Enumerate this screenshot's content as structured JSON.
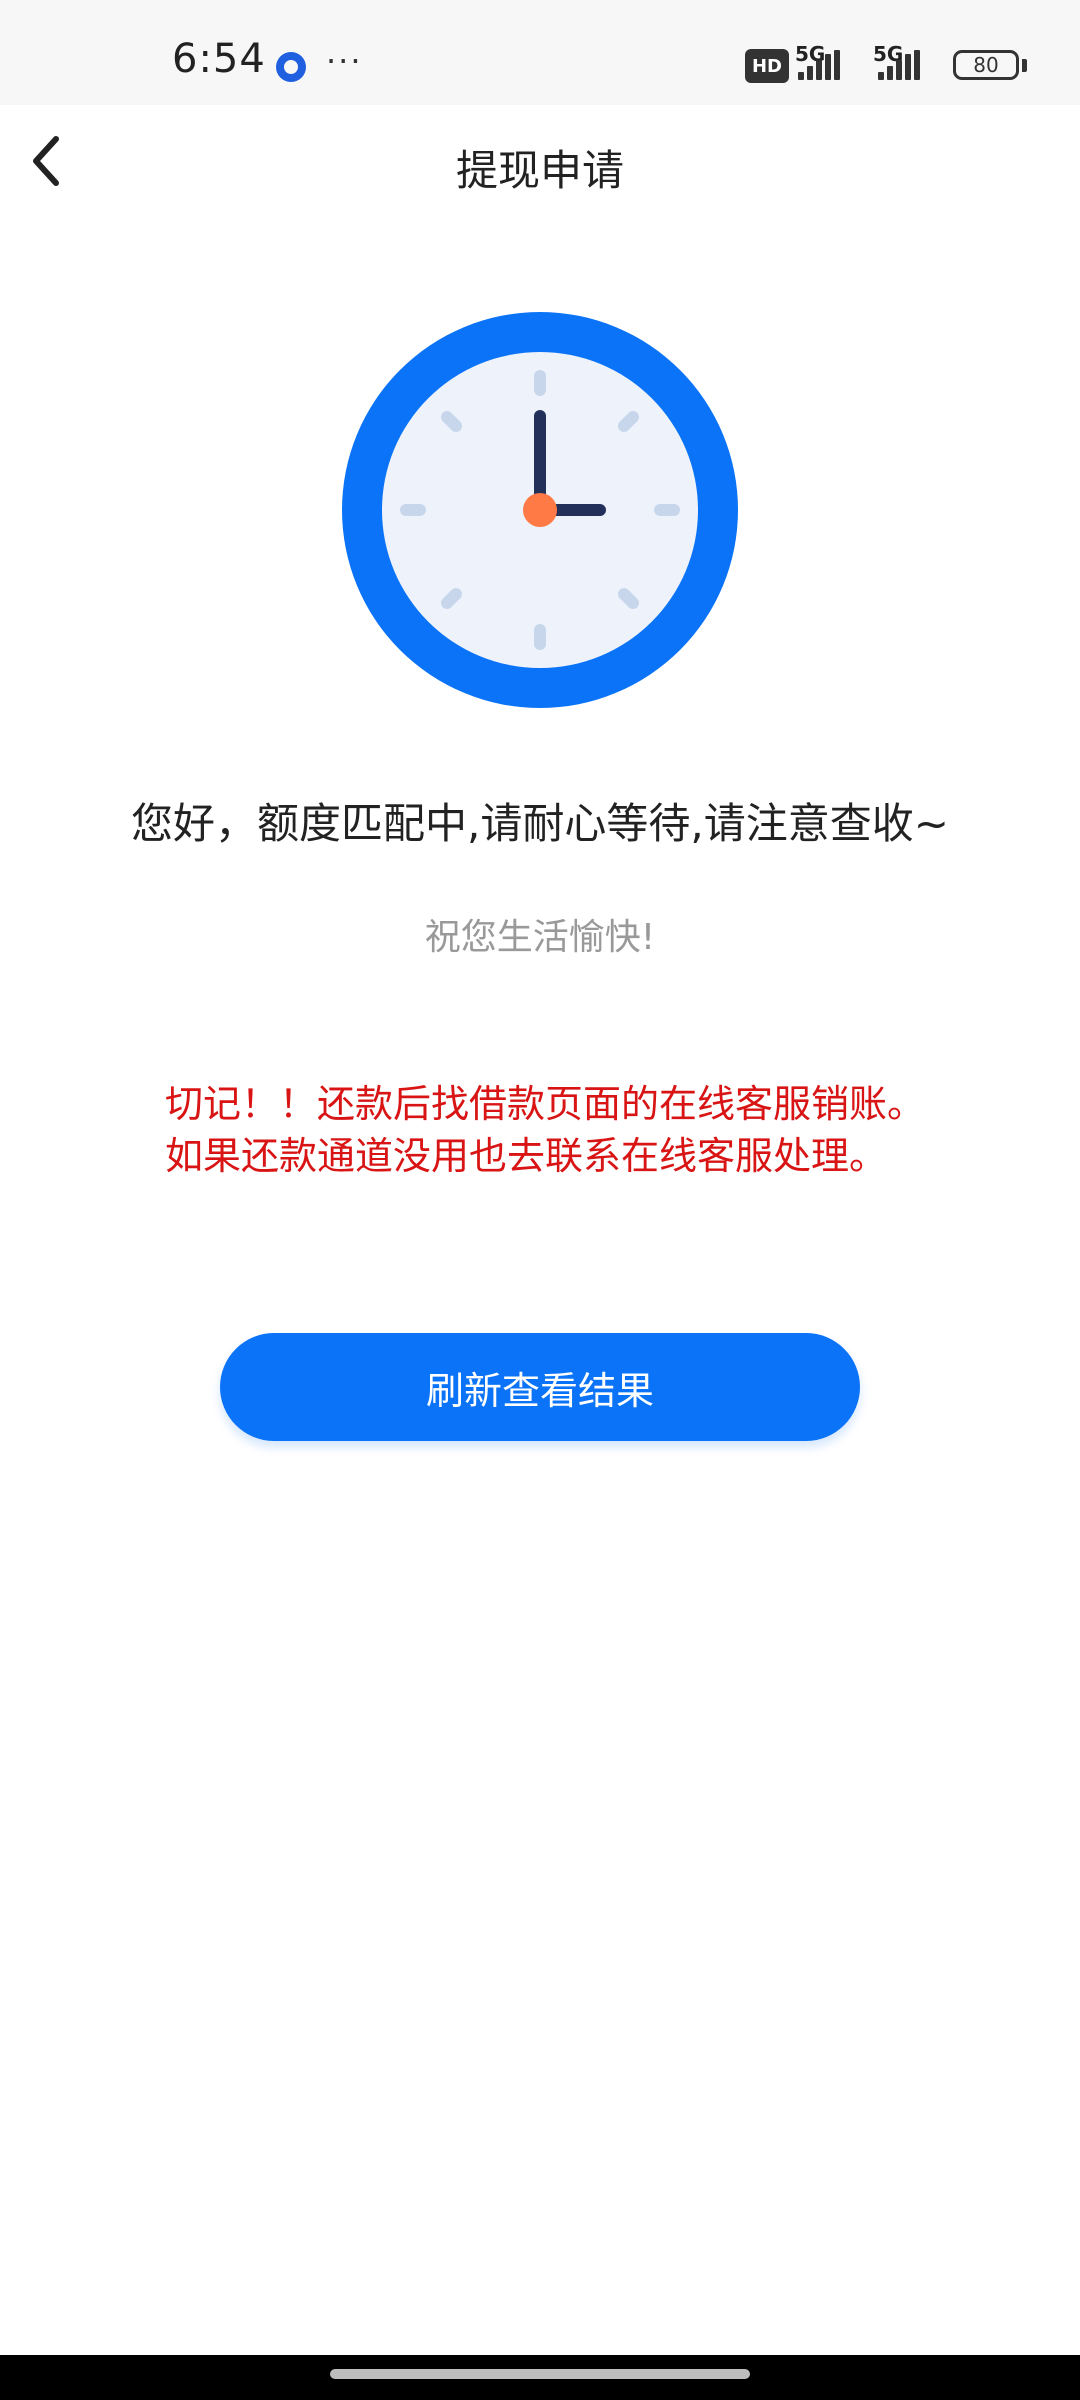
{
  "status_bar": {
    "time": "6:54",
    "more": "···",
    "hd": "HD",
    "sim1": "5G",
    "sim2": "5G",
    "battery": "80"
  },
  "nav": {
    "title": "提现申请",
    "back_icon": "chevron-left-icon"
  },
  "clock_icon": {
    "ring_color": "#0a73f7",
    "face_color": "#eef3fb",
    "hand_color": "#23305a",
    "center_color": "#ff7a45"
  },
  "content": {
    "message": "您好，额度匹配中,请耐心等待,请注意查收~",
    "greeting": "祝您生活愉快!",
    "warning": "切记！！还款后找借款页面的在线客服销账。如果还款通道没用也去联系在线客服处理。"
  },
  "actions": {
    "refresh_label": "刷新查看结果"
  },
  "colors": {
    "accent": "#0a73f7",
    "warning": "#d91414"
  }
}
